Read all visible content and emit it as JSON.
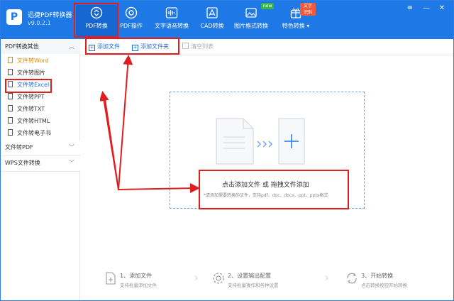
{
  "app": {
    "name": "迅捷PDF转换器",
    "version": "v9.0.2.1"
  },
  "tabs": [
    {
      "label": "PDF转换",
      "icon": "pdf-convert-icon"
    },
    {
      "label": "PDF操作",
      "icon": "pdf-operate-icon"
    },
    {
      "label": "文字语音转换",
      "icon": "audio-wave-icon"
    },
    {
      "label": "CAD转换",
      "icon": "cad-icon"
    },
    {
      "label": "图片格式转换",
      "icon": "image-icon"
    },
    {
      "label": "特色转换",
      "icon": "gift-icon"
    }
  ],
  "badges": {
    "new": "new",
    "ocr": "文字识别"
  },
  "sidebar": {
    "group1": "PDF转换其他",
    "items": [
      "文件转Word",
      "文件转图片",
      "文件转Excel",
      "文件转PPT",
      "文件转TXT",
      "文件转HTML",
      "文件转电子书"
    ],
    "group2": "文件转PDF",
    "group3": "WPS文件转换"
  },
  "toolbar": {
    "add_file": "添加文件",
    "add_folder": "添加文件夹",
    "clear": "清空列表"
  },
  "drop": {
    "main": "点击添加文件 或 拖拽文件添加",
    "sub": "*请添加需要转换的文件，支持pdf、doc、docx、ppt、pptx格式"
  },
  "steps": [
    {
      "title": "1、添加文件",
      "desc": "支持批量添加文件"
    },
    {
      "title": "2、设置输出配置",
      "desc": "支持批量操作和各种设置"
    },
    {
      "title": "3、开始转换",
      "desc": "点击转换按钮开始转换"
    }
  ],
  "colors": {
    "brand": "#1e78e6",
    "annotation": "#e11d1d",
    "selected": "#e68a00",
    "badge_new": "#3bb54a",
    "badge_ocr": "#f05a3c"
  }
}
